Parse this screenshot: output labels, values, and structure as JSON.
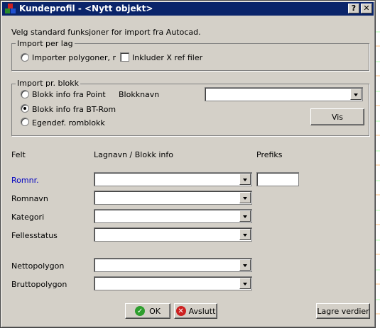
{
  "window": {
    "title": "Kundeprofil - <Nytt objekt>",
    "help_button": "?",
    "close_button": "✕"
  },
  "intro_text": "Velg standard funksjoner for import fra Autocad.",
  "import_per_lag": {
    "legend": "Import per lag",
    "import_polygons_label": "Importer polygoner, r",
    "include_xref_label": "Inkluder X ref filer"
  },
  "import_per_blokk": {
    "legend": "Import pr. blokk",
    "options": [
      {
        "label": "Blokk info fra Point",
        "selected": false
      },
      {
        "label": "Blokk info fra BT-Rom",
        "selected": true
      },
      {
        "label": "Egendef. romblokk",
        "selected": false
      }
    ],
    "blokknavn_label": "Blokknavn",
    "blokknavn_value": "",
    "vis_button": "Vis"
  },
  "mapping": {
    "headers": {
      "felt": "Felt",
      "lagnavn": "Lagnavn / Blokk info",
      "prefiks": "Prefiks"
    },
    "rows": [
      {
        "label": "Romnr.",
        "value": "",
        "highlight": true
      },
      {
        "label": "Romnavn",
        "value": ""
      },
      {
        "label": "Kategori",
        "value": ""
      },
      {
        "label": "Fellesstatus",
        "value": ""
      },
      {
        "label": "Nettopolygon",
        "value": ""
      },
      {
        "label": "Bruttopolygon",
        "value": ""
      }
    ],
    "prefiks_value": ""
  },
  "buttons": {
    "ok": "OK",
    "avslutt": "Avslutt",
    "lagre": "Lagre verdier"
  },
  "colors": {
    "titlebar": "#0a246a",
    "highlight_label": "#0000c0",
    "ok_icon": "#2e9e2e",
    "cancel_icon": "#cc2020"
  }
}
